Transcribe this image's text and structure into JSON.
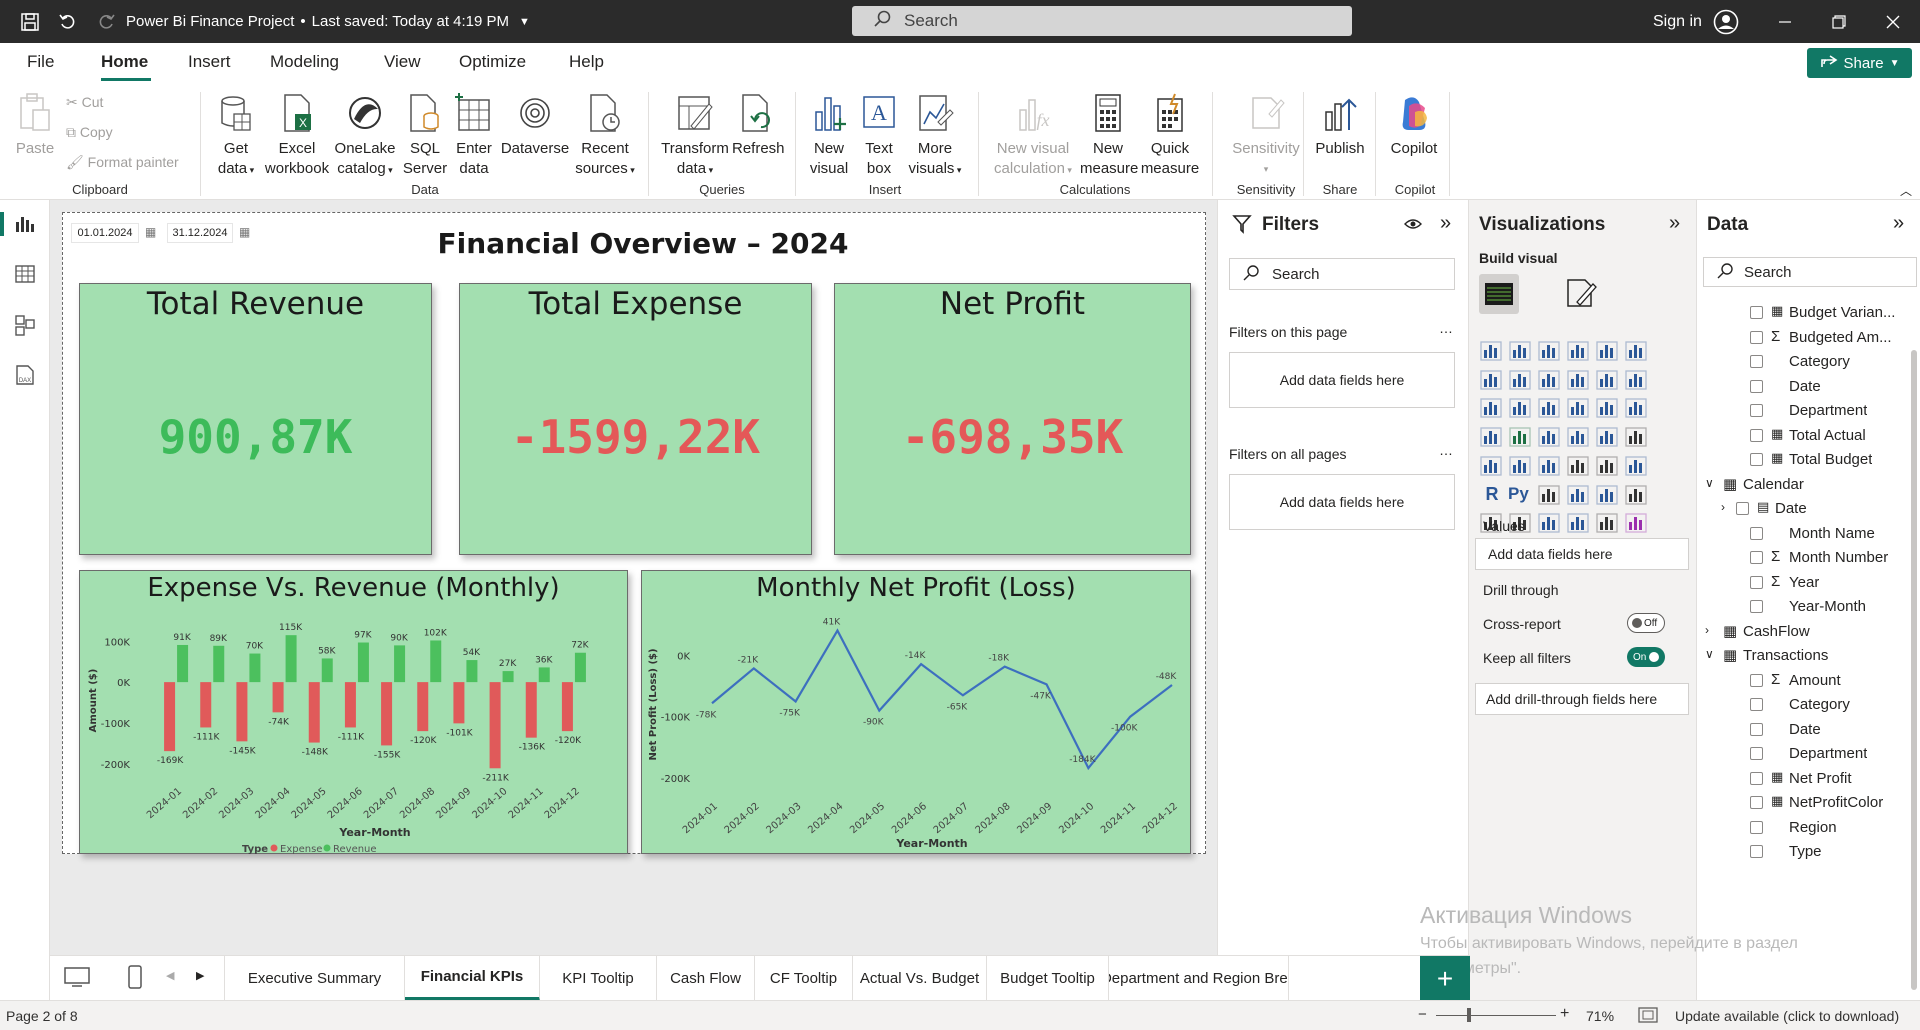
{
  "titlebar": {
    "title": "Power Bi Finance Project",
    "saved": "Last saved: Today at 4:19 PM",
    "search_placeholder": "Search",
    "signin": "Sign in"
  },
  "menu": {
    "items": [
      "File",
      "Home",
      "Insert",
      "Modeling",
      "View",
      "Optimize",
      "Help"
    ],
    "share": "Share"
  },
  "ribbon": {
    "clipboard": {
      "paste": "Paste",
      "cut": "Cut",
      "copy": "Copy",
      "format_painter": "Format painter",
      "group": "Clipboard"
    },
    "data": {
      "get_data": [
        "Get",
        "data"
      ],
      "excel": [
        "Excel",
        "workbook"
      ],
      "onelake": [
        "OneLake",
        "catalog"
      ],
      "sql": [
        "SQL",
        "Server"
      ],
      "enter": [
        "Enter",
        "data"
      ],
      "dataverse": "Dataverse",
      "recent": [
        "Recent",
        "sources"
      ],
      "group": "Data"
    },
    "queries": {
      "transform": [
        "Transform",
        "data"
      ],
      "refresh": "Refresh",
      "group": "Queries"
    },
    "insert": {
      "new_visual": [
        "New",
        "visual"
      ],
      "text_box": [
        "Text",
        "box"
      ],
      "more_visuals": [
        "More",
        "visuals"
      ],
      "group": "Insert"
    },
    "calculations": {
      "new_visual_calc": [
        "New visual",
        "calculation"
      ],
      "new_measure": [
        "New",
        "measure"
      ],
      "quick_measure": [
        "Quick",
        "measure"
      ],
      "group": "Calculations"
    },
    "sensitivity": {
      "label": "Sensitivity",
      "group": "Sensitivity"
    },
    "share": {
      "publish": "Publish",
      "group": "Share"
    },
    "copilot": {
      "label": "Copilot",
      "group": "Copilot"
    }
  },
  "report": {
    "date_from": "01.01.2024",
    "date_to": "31.12.2024",
    "title": "Financial Overview – 2024",
    "kpis": [
      {
        "label": "Total Revenue",
        "value": "900,87K",
        "color": "#3dbb5a"
      },
      {
        "label": "Total Expense",
        "value": "-1599,22K",
        "color": "#e45858"
      },
      {
        "label": "Net Profit",
        "value": "-698,35K",
        "color": "#e45858"
      }
    ]
  },
  "chart_data": [
    {
      "type": "bar",
      "title": "Expense Vs. Revenue (Monthly)",
      "xlabel": "Year-Month",
      "ylabel": "Amount ($)",
      "categories": [
        "2024-01",
        "2024-02",
        "2024-03",
        "2024-04",
        "2024-05",
        "2024-06",
        "2024-07",
        "2024-08",
        "2024-09",
        "2024-10",
        "2024-11",
        "2024-12"
      ],
      "yticks": [
        "100K",
        "0K",
        "-100K",
        "-200K"
      ],
      "ylim": [
        -200,
        120
      ],
      "legend_title": "Type",
      "series": [
        {
          "name": "Expense",
          "color": "#e05a5a",
          "values": [
            -169,
            -111,
            -145,
            -74,
            -148,
            -111,
            -155,
            -120,
            -101,
            -211,
            -136,
            -120
          ],
          "labels": [
            "-169K",
            "-111K",
            "-145K",
            "-74K",
            "-148K",
            "-111K",
            "-155K",
            "-120K",
            "-101K",
            "-211K",
            "-136K",
            "-120K"
          ]
        },
        {
          "name": "Revenue",
          "color": "#4cc05e",
          "values": [
            91,
            89,
            70,
            115,
            58,
            97,
            90,
            102,
            54,
            27,
            36,
            72
          ],
          "labels": [
            "91K",
            "89K",
            "70K",
            "115K",
            "58K",
            "97K",
            "90K",
            "102K",
            "54K",
            "27K",
            "36K",
            "72K"
          ]
        }
      ]
    },
    {
      "type": "line",
      "title": "Monthly Net Profit (Loss)",
      "xlabel": "Year-Month",
      "ylabel": "Net Profit (Loss) ($)",
      "categories": [
        "2024-01",
        "2024-02",
        "2024-03",
        "2024-04",
        "2024-05",
        "2024-06",
        "2024-07",
        "2024-08",
        "2024-09",
        "2024-10",
        "2024-11",
        "2024-12"
      ],
      "yticks": [
        "0K",
        "-100K",
        "-200K"
      ],
      "ylim": [
        -200,
        30
      ],
      "series": [
        {
          "name": "Net Profit",
          "color": "#3d6fbf",
          "values": [
            -78,
            -21,
            -75,
            41,
            -90,
            -14,
            -65,
            -18,
            -47,
            -184,
            -100,
            -48
          ],
          "labels": [
            "-78K",
            "-21K",
            "-75K",
            "41K",
            "-90K",
            "-14K",
            "-65K",
            "-18K",
            "-47K",
            "-184K",
            "-100K",
            "-48K"
          ]
        }
      ]
    }
  ],
  "filters": {
    "title": "Filters",
    "search": "Search",
    "on_page": "Filters on this page",
    "on_all": "Filters on all pages",
    "add": "Add data fields here"
  },
  "visualizations": {
    "title": "Visualizations",
    "build": "Build visual",
    "values": "Values",
    "add": "Add data fields here",
    "drill": "Drill through",
    "cross": "Cross-report",
    "cross_state": "Off",
    "keep": "Keep all filters",
    "keep_state": "On",
    "add_drill": "Add drill-through fields here"
  },
  "data_pane": {
    "title": "Data",
    "search": "Search",
    "items": [
      {
        "label": "Budget Varian...",
        "indent": 2,
        "icon": "calc"
      },
      {
        "label": "Budgeted Am...",
        "indent": 2,
        "icon": "sigma"
      },
      {
        "label": "Category",
        "indent": 2,
        "icon": ""
      },
      {
        "label": "Date",
        "indent": 2,
        "icon": ""
      },
      {
        "label": "Department",
        "indent": 2,
        "icon": ""
      },
      {
        "label": "Total Actual",
        "indent": 2,
        "icon": "calc"
      },
      {
        "label": "Total Budget",
        "indent": 2,
        "icon": "calc"
      },
      {
        "label": "Calendar",
        "indent": 0,
        "icon": "table",
        "exp": "down"
      },
      {
        "label": "Date",
        "indent": 1,
        "icon": "cal",
        "exp": "right"
      },
      {
        "label": "Month Name",
        "indent": 2,
        "icon": ""
      },
      {
        "label": "Month Number",
        "indent": 2,
        "icon": "sigma"
      },
      {
        "label": "Year",
        "indent": 2,
        "icon": "sigma"
      },
      {
        "label": "Year-Month",
        "indent": 2,
        "icon": ""
      },
      {
        "label": "CashFlow",
        "indent": 0,
        "icon": "table",
        "exp": "right"
      },
      {
        "label": "Transactions",
        "indent": 0,
        "icon": "table",
        "exp": "down"
      },
      {
        "label": "Amount",
        "indent": 2,
        "icon": "sigma"
      },
      {
        "label": "Category",
        "indent": 2,
        "icon": ""
      },
      {
        "label": "Date",
        "indent": 2,
        "icon": ""
      },
      {
        "label": "Department",
        "indent": 2,
        "icon": ""
      },
      {
        "label": "Net Profit",
        "indent": 2,
        "icon": "calc"
      },
      {
        "label": "NetProfitColor",
        "indent": 2,
        "icon": "calc"
      },
      {
        "label": "Region",
        "indent": 2,
        "icon": ""
      },
      {
        "label": "Type",
        "indent": 2,
        "icon": ""
      }
    ]
  },
  "tabs": [
    "Executive Summary",
    "Financial KPIs",
    "KPI Tooltip",
    "Cash Flow",
    "CF Tooltip",
    "Actual Vs. Budget",
    "Budget Tooltip",
    "Department and Region Brea"
  ],
  "active_tab": 1,
  "watermark": {
    "line1": "Активация Windows",
    "line2": "Чтобы активировать Windows, перейдите в раздел",
    "line3": "\"Параметры\"."
  },
  "status": {
    "page": "Page 2 of 8",
    "zoom": "71%",
    "update": "Update available (click to download)"
  }
}
